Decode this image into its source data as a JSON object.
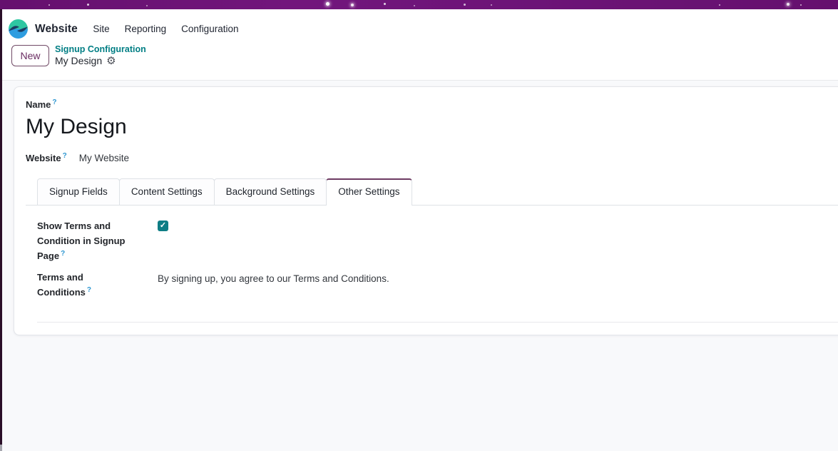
{
  "navbar": {
    "brand": "Website",
    "menus": [
      {
        "label": "Site"
      },
      {
        "label": "Reporting"
      },
      {
        "label": "Configuration"
      }
    ]
  },
  "control_panel": {
    "new_button_label": "New",
    "breadcrumb_parent": "Signup Configuration",
    "breadcrumb_current": "My Design"
  },
  "form": {
    "help_marker": "?",
    "name": {
      "label": "Name",
      "value": "My Design"
    },
    "website": {
      "label": "Website",
      "value": "My Website"
    },
    "tabs": [
      {
        "label": "Signup Fields",
        "active": false
      },
      {
        "label": "Content Settings",
        "active": false
      },
      {
        "label": "Background Settings",
        "active": false
      },
      {
        "label": "Other Settings",
        "active": true
      }
    ],
    "other_settings": {
      "show_terms": {
        "label": "Show Terms and Condition in Signup Page",
        "checked": true
      },
      "terms": {
        "label": "Terms and Conditions",
        "value": "By signing up, you agree to our Terms and Conditions."
      }
    }
  },
  "icons": {
    "gear": "⚙",
    "check": "✓"
  },
  "colors": {
    "topbar_purple": "#6d1478",
    "accent_purple": "#714B67",
    "teal": "#017e84",
    "checkbox_teal": "#0e7d85",
    "help_blue": "#2e97d1",
    "page_background": "#f8f9fb"
  }
}
